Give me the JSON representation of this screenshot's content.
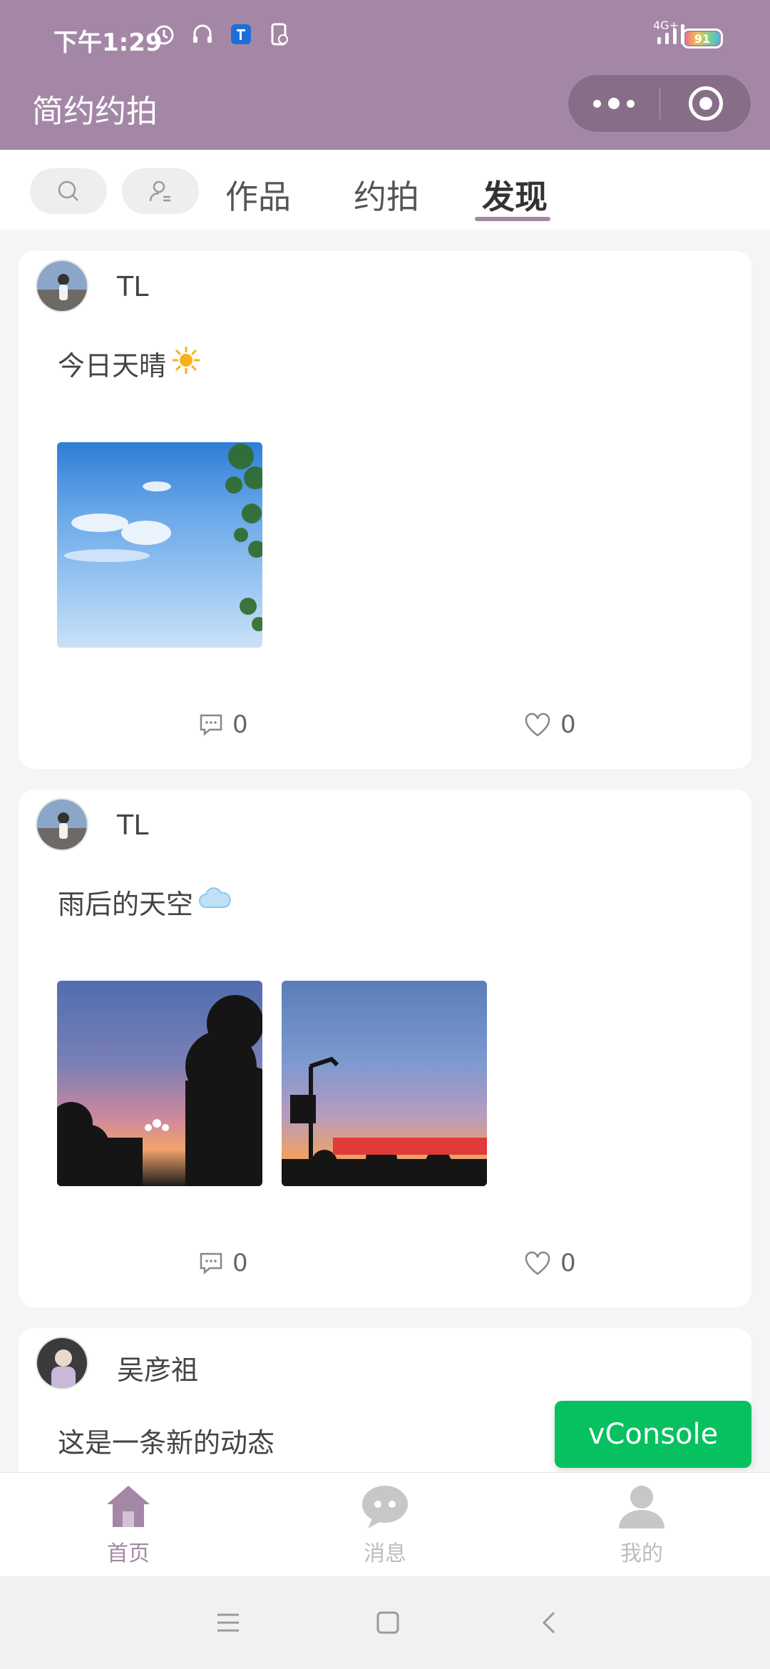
{
  "status_bar": {
    "time": "下午1:29",
    "network": "4G+",
    "battery": "91"
  },
  "app": {
    "title": "简约约拍"
  },
  "tabs": [
    {
      "label": "作品"
    },
    {
      "label": "约拍"
    },
    {
      "label": "发现",
      "active": true
    }
  ],
  "posts": [
    {
      "username": "TL",
      "text": "今日天晴",
      "emoji": "sun",
      "comments": "0",
      "likes": "0"
    },
    {
      "username": "TL",
      "text": "雨后的天空",
      "emoji": "cloud",
      "comments": "0",
      "likes": "0"
    },
    {
      "username": "吴彦祖",
      "text": "这是一条新的动态"
    }
  ],
  "floating": {
    "vconsole": "vConsole",
    "fab": "+"
  },
  "bottom_nav": [
    {
      "label": "首页",
      "icon": "home-icon",
      "active": true
    },
    {
      "label": "消息",
      "icon": "chat-icon"
    },
    {
      "label": "我的",
      "icon": "person-icon"
    }
  ],
  "colors": {
    "brand": "#a487a6",
    "vconsole": "#07c160"
  }
}
